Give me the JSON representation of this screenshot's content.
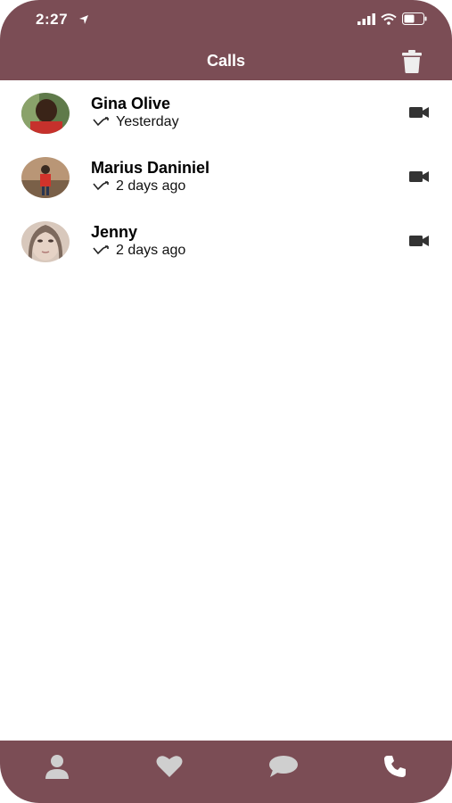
{
  "status": {
    "time": "2:27"
  },
  "header": {
    "title": "Calls"
  },
  "calls": [
    {
      "name": "Gina Olive",
      "when": "Yesterday",
      "avatar_bg": "#8a5a3c"
    },
    {
      "name": "Marius Daniniel",
      "when": "2 days ago",
      "avatar_bg": "#b08560"
    },
    {
      "name": "Jenny",
      "when": "2 days ago",
      "avatar_bg": "#cdb6a6"
    }
  ],
  "tabs": [
    {
      "icon": "person-icon"
    },
    {
      "icon": "heart-icon"
    },
    {
      "icon": "chat-bubble-icon"
    },
    {
      "icon": "phone-icon"
    }
  ],
  "colors": {
    "brand": "#7b4d55",
    "tab_icon": "#cfcfcf",
    "active_tab_icon": "#ffffff"
  }
}
